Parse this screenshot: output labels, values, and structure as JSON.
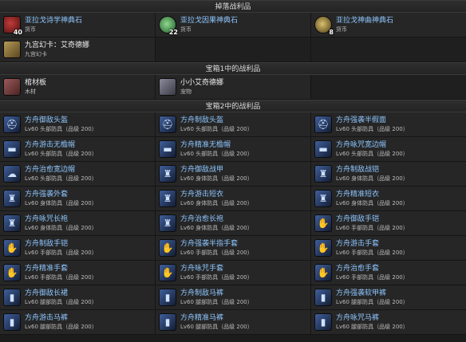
{
  "sections": [
    {
      "title": "掉落战利品",
      "items": [
        {
          "name": "亚拉戈诗学神典石",
          "sub": "货币",
          "count": "40",
          "icon": "red",
          "icon_name": "tomestone-icon",
          "color": "blue"
        },
        {
          "name": "亚拉戈因果神典石",
          "sub": "货币",
          "count": "22",
          "icon": "green",
          "icon_name": "tomestone-icon",
          "color": "blue"
        },
        {
          "name": "亚拉戈神曲神典石",
          "sub": "货币",
          "count": "8",
          "icon": "gold",
          "icon_name": "tomestone-icon",
          "color": "blue"
        },
        {
          "name": "九宫幻卡：艾奇德娜",
          "sub": "九宫幻卡",
          "count": "",
          "icon": "card",
          "icon_name": "card-icon",
          "color": "white"
        },
        null,
        null
      ]
    },
    {
      "title": "宝箱1中的战利品",
      "items": [
        {
          "name": "棺材板",
          "sub": "木材",
          "count": "",
          "icon": "wood",
          "icon_name": "lumber-icon",
          "color": "white"
        },
        {
          "name": "小小艾奇德娜",
          "sub": "宠物",
          "count": "",
          "icon": "toy",
          "icon_name": "minion-icon",
          "color": "white"
        },
        null
      ]
    },
    {
      "title": "宝箱2中的战利品",
      "items": [
        {
          "name": "方舟御敌头盔",
          "sub": "Lv60 头部防具（品级 200）",
          "glyph": "⛑"
        },
        {
          "name": "方舟制敌头盔",
          "sub": "Lv60 头部防具（品级 200）",
          "glyph": "⛑"
        },
        {
          "name": "方舟强袭半假面",
          "sub": "Lv60 头部防具（品级 200）",
          "glyph": "⛑"
        },
        {
          "name": "方舟游击无檐帽",
          "sub": "Lv60 头部防具（品级 200）",
          "glyph": "▬"
        },
        {
          "name": "方舟精准无檐帽",
          "sub": "Lv60 头部防具（品级 200）",
          "glyph": "▬"
        },
        {
          "name": "方舟咏咒宽边帽",
          "sub": "Lv60 头部防具（品级 200）",
          "glyph": "▬"
        },
        {
          "name": "方舟治愈宽边帽",
          "sub": "Lv60 头部防具（品级 200）",
          "glyph": "☁"
        },
        {
          "name": "方舟御敌战甲",
          "sub": "Lv60 身体防具（品级 200）",
          "glyph": "♜"
        },
        {
          "name": "方舟制敌战铠",
          "sub": "Lv60 身体防具（品级 200）",
          "glyph": "♜"
        },
        {
          "name": "方舟强袭外套",
          "sub": "Lv60 身体防具（品级 200）",
          "glyph": "♜"
        },
        {
          "name": "方舟游击短衣",
          "sub": "Lv60 身体防具（品级 200）",
          "glyph": "♜"
        },
        {
          "name": "方舟精准短衣",
          "sub": "Lv60 身体防具（品级 200）",
          "glyph": "♜"
        },
        {
          "name": "方舟咏咒长袍",
          "sub": "Lv60 身体防具（品级 200）",
          "glyph": "♜"
        },
        {
          "name": "方舟治愈长袍",
          "sub": "Lv60 身体防具（品级 200）",
          "glyph": "♜"
        },
        {
          "name": "方舟御敌手铠",
          "sub": "Lv60 手部防具（品级 200）",
          "glyph": "✋"
        },
        {
          "name": "方舟制敌手铠",
          "sub": "Lv60 手部防具（品级 200）",
          "glyph": "✋"
        },
        {
          "name": "方舟强袭半指手套",
          "sub": "Lv60 手部防具（品级 200）",
          "glyph": "✋"
        },
        {
          "name": "方舟游击手套",
          "sub": "Lv60 手部防具（品级 200）",
          "glyph": "✋"
        },
        {
          "name": "方舟精准手套",
          "sub": "Lv60 手部防具（品级 200）",
          "glyph": "✋"
        },
        {
          "name": "方舟咏咒手套",
          "sub": "Lv60 手部防具（品级 200）",
          "glyph": "✋"
        },
        {
          "name": "方舟治愈手套",
          "sub": "Lv60 手部防具（品级 200）",
          "glyph": "✋"
        },
        {
          "name": "方舟御敌长裙",
          "sub": "Lv60 腿部防具（品级 200）",
          "glyph": "▮"
        },
        {
          "name": "方舟制敌马裤",
          "sub": "Lv60 腿部防具（品级 200）",
          "glyph": "▮"
        },
        {
          "name": "方舟强袭软甲裤",
          "sub": "Lv60 腿部防具（品级 200）",
          "glyph": "▮"
        },
        {
          "name": "方舟游击马裤",
          "sub": "Lv60 腿部防具（品级 200）",
          "glyph": "▮"
        },
        {
          "name": "方舟精准马裤",
          "sub": "Lv60 腿部防具（品级 200）",
          "glyph": "▮"
        },
        {
          "name": "方舟咏咒马裤",
          "sub": "Lv60 腿部防具（品级 200）",
          "glyph": "▮"
        }
      ]
    }
  ]
}
